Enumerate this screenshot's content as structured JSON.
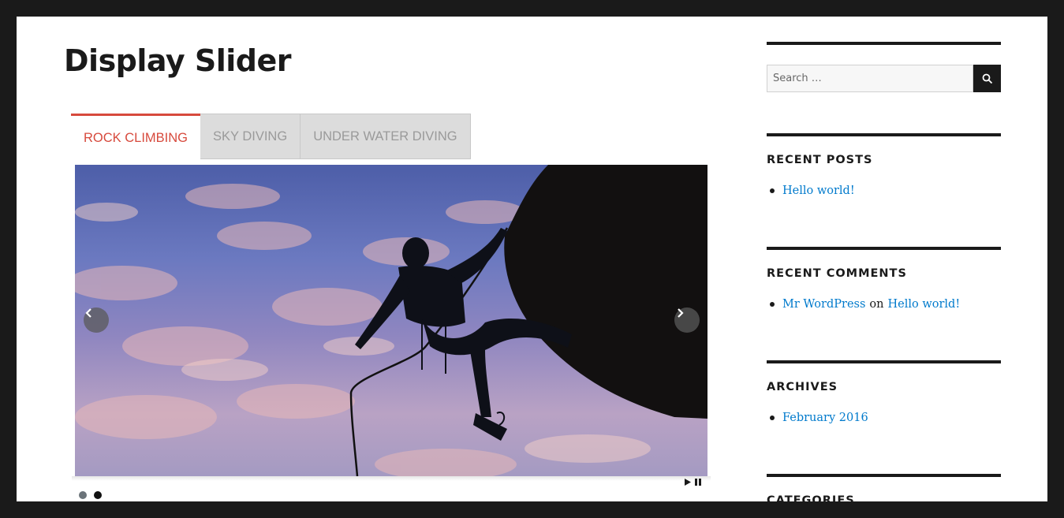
{
  "main": {
    "page_title": "Display Slider",
    "tabs": [
      {
        "label": "ROCK CLIMBING",
        "active": true
      },
      {
        "label": "SKY DIVING",
        "active": false
      },
      {
        "label": "UNDER WATER DIVING",
        "active": false
      }
    ],
    "slider": {
      "image": "rock-climber-silhouette",
      "slides_count": 2,
      "current_slide": 2
    }
  },
  "sidebar": {
    "search": {
      "placeholder": "Search …"
    },
    "recent_posts": {
      "title": "RECENT POSTS",
      "items": [
        "Hello world!"
      ]
    },
    "recent_comments": {
      "title": "RECENT COMMENTS",
      "author": "Mr WordPress",
      "on_text": "on",
      "post": "Hello world!"
    },
    "archives": {
      "title": "ARCHIVES",
      "items": [
        "February 2016"
      ]
    },
    "categories": {
      "title": "CATEGORIES"
    }
  },
  "colors": {
    "accent": "#d74a3d",
    "link": "#007acc",
    "frame": "#1a1a1a"
  }
}
